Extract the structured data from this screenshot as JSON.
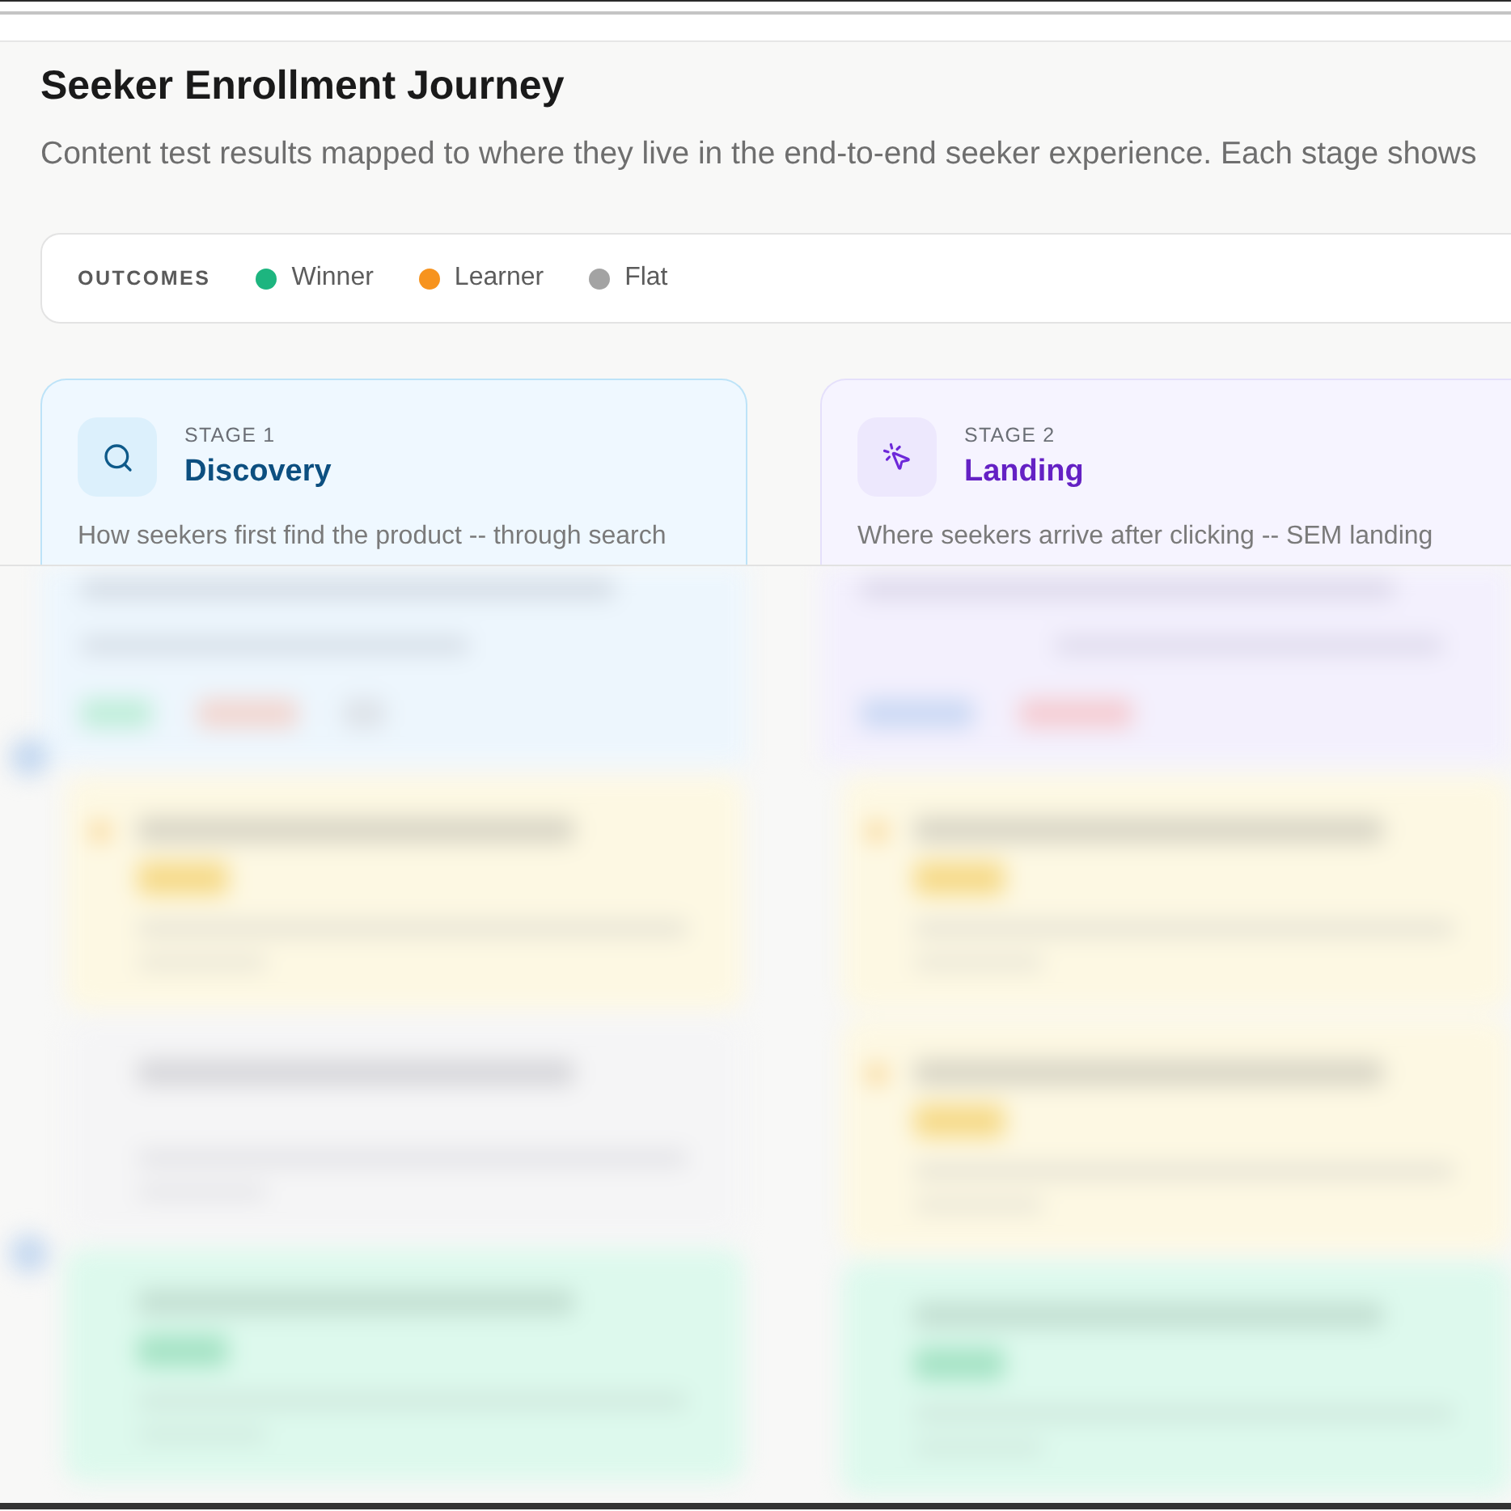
{
  "header": {
    "title": "Seeker Enrollment Journey",
    "subtitle": "Content test results mapped to where they live in the end-to-end seeker experience. Each stage shows"
  },
  "legend": {
    "label": "OUTCOMES",
    "items": [
      {
        "label": "Winner",
        "color": "#1db57f"
      },
      {
        "label": "Learner",
        "color": "#f7931e"
      },
      {
        "label": "Flat",
        "color": "#a3a3a3"
      }
    ]
  },
  "stages": [
    {
      "kind": "search",
      "stage": "STAGE 1",
      "title": "Discovery",
      "color": "#0c4f80",
      "description": "How seekers first find the product -- through search",
      "cards": [
        {
          "kind": "learner"
        },
        {
          "kind": "flat"
        },
        {
          "kind": "winner"
        }
      ]
    },
    {
      "kind": "click",
      "stage": "STAGE 2",
      "title": "Landing",
      "color": "#6421c4",
      "description": "Where seekers arrive after clicking -- SEM landing",
      "cards": [
        {
          "kind": "learner"
        },
        {
          "kind": "learner"
        },
        {
          "kind": "winner"
        }
      ]
    }
  ]
}
